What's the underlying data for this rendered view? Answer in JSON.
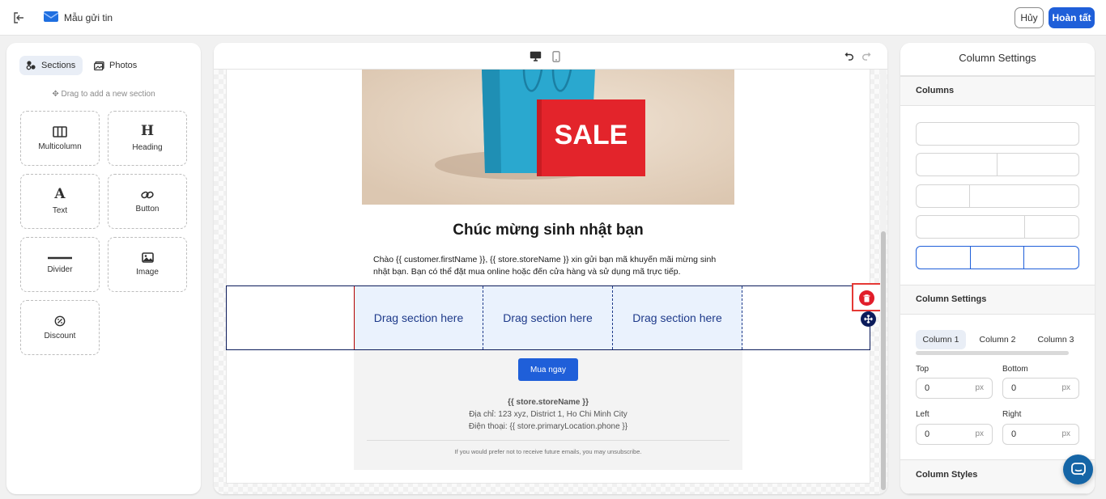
{
  "topbar": {
    "exit_icon": "exit-icon",
    "app_icon": "email-icon",
    "title": "Mẫu gửi tin",
    "cancel_label": "Hủy",
    "done_label": "Hoàn tất"
  },
  "left_panel": {
    "tabs": [
      {
        "label": "Sections",
        "icon": "sections-icon",
        "active": true
      },
      {
        "label": "Photos",
        "icon": "photos-icon",
        "active": false
      }
    ],
    "drag_hint": "Drag to add a new section",
    "tiles": [
      {
        "label": "Multicolumn",
        "icon": "multicolumn-icon"
      },
      {
        "label": "Heading",
        "icon": "heading-icon"
      },
      {
        "label": "Text",
        "icon": "text-icon"
      },
      {
        "label": "Button",
        "icon": "link-icon"
      },
      {
        "label": "Divider",
        "icon": "divider-icon"
      },
      {
        "label": "Image",
        "icon": "image-icon"
      },
      {
        "label": "Discount",
        "icon": "discount-icon"
      }
    ]
  },
  "canvas": {
    "device_icons": [
      "desktop-icon",
      "mobile-icon"
    ],
    "undo_icon": "undo-icon",
    "redo_icon": "redo-icon",
    "hero_sign_text": "SALE",
    "heading": "Chúc mừng sinh nhật bạn",
    "paragraph": "Chào {{ customer.firstName }}, {{ store.storeName }} xin gửi bạn mã khuyến mãi mừng sinh nhật bạn. Bạn có thể đặt mua online hoặc đến cửa hàng và sử dụng mã trực tiếp.",
    "drop_zones": [
      "Drag section here",
      "Drag section here",
      "Drag section here"
    ],
    "buy_button": "Mua ngay",
    "store_name": "{{ store.storeName }}",
    "address": "Địa chỉ: 123 xyz, District 1, Ho Chi Minh City",
    "phone": "Điện thoại: {{ store.primaryLocation.phone }}",
    "unsubscribe": "If you would prefer not to receive future emails, you may unsubscribe."
  },
  "right_panel": {
    "title": "Column Settings",
    "columns_heading": "Columns",
    "selected_layout_index": 4,
    "column_settings_heading": "Column Settings",
    "column_tabs": [
      "Column 1",
      "Column 2",
      "Column 3"
    ],
    "active_column_tab": 0,
    "padding": {
      "top_label": "Top",
      "top_value": "0",
      "bottom_label": "Bottom",
      "bottom_value": "0",
      "left_label": "Left",
      "left_value": "0",
      "right_label": "Right",
      "right_value": "0",
      "unit": "px"
    },
    "column_styles_heading": "Column Styles"
  },
  "chat_icon": "chat-icon",
  "colors": {
    "primary": "#1f5fd9",
    "selection_border": "#0b1b5a",
    "drop_zone_bg": "#eaf2fd",
    "delete_red": "#e11d2a",
    "hero_sign_red": "#e3242b",
    "hero_bag_blue": "#2aa8cf"
  }
}
